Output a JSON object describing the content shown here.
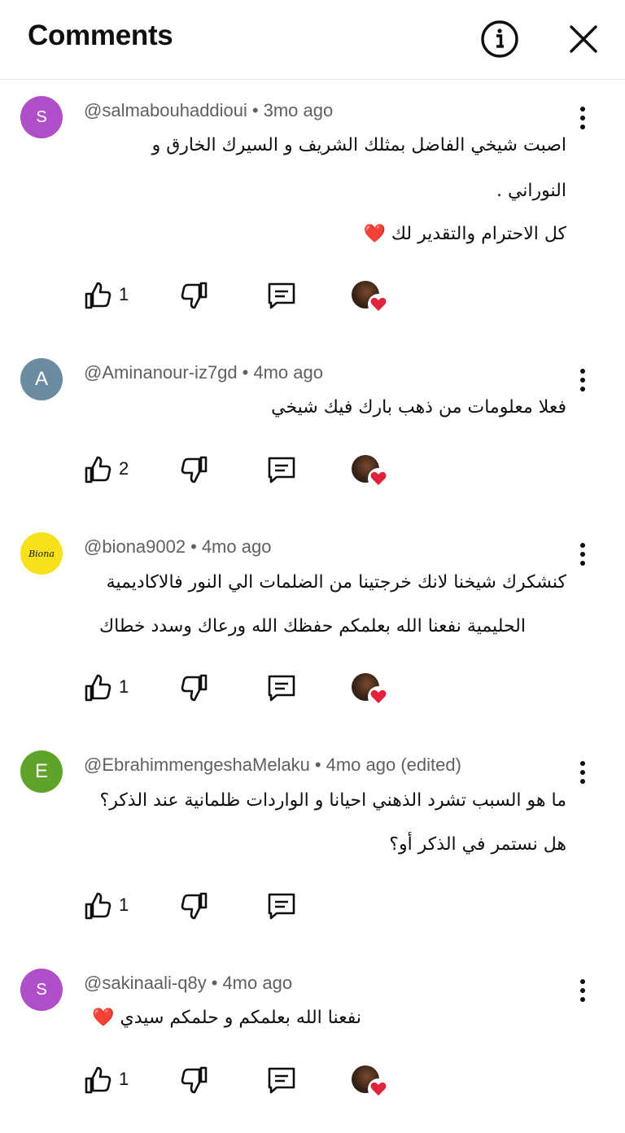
{
  "header": {
    "title": "Comments"
  },
  "comments": [
    {
      "avatar_letter": "S",
      "avatar_color": "#b04fc8",
      "handle": "@salmabouhaddioui",
      "time": "3mo ago",
      "lines": [
        "اصبت شيخي الفاضل بمثلك الشريف و السيرك الخارق و",
        "النوراني .",
        "كل الاحترام والتقدير لك ❤️"
      ],
      "likes": "1",
      "creator_hearted": true
    },
    {
      "avatar_letter": "A",
      "avatar_color": "#6b8ca0",
      "handle": "@Aminanour-iz7gd",
      "time": "4mo ago",
      "lines": [
        "فعلا معلومات من ذهب بارك فيك شيخي"
      ],
      "likes": "2",
      "creator_hearted": true
    },
    {
      "avatar_letter": "Biona",
      "avatar_color": "#f6e11a",
      "handle": "@biona9002",
      "time": "4mo ago",
      "lines": [
        "كنشكرك شيخنا لانك خرجتينا من الضلمات الي النور فالاكاديمية",
        "الحليمية  نفعنا الله بعلمكم حفظك الله ورعاك وسدد خطاك"
      ],
      "likes": "1",
      "creator_hearted": true
    },
    {
      "avatar_letter": "E",
      "avatar_color": "#5fa32a",
      "handle": "@EbrahimmengeshaMelaku",
      "time": "4mo ago (edited)",
      "lines": [
        "ما هو السبب تشرد الذهني احيانا و الواردات ظلمانية عند الذكر؟",
        "هل نستمر في الذكر أو؟"
      ],
      "likes": "1",
      "creator_hearted": false
    },
    {
      "avatar_letter": "S",
      "avatar_color": "#b04fc8",
      "handle": "@sakinaali-q8y",
      "time": "4mo ago",
      "lines": [
        "نفعنا الله بعلمكم و حلمكم سيدي ❤️"
      ],
      "likes": "1",
      "creator_hearted": true
    }
  ]
}
